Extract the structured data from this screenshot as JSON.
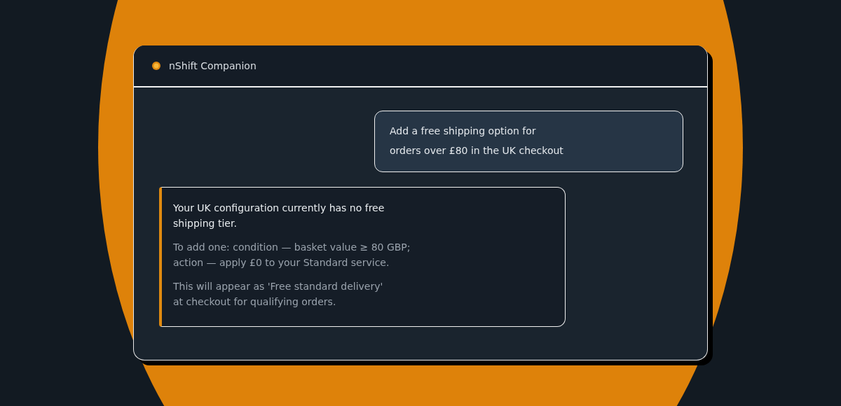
{
  "window": {
    "title": "nShift Companion"
  },
  "messages": [
    {
      "kind": "user",
      "paragraphs": [
        "Add a free shipping option for\norders over £80 in the UK checkout"
      ]
    },
    {
      "kind": "assistant",
      "paragraphs": [
        "Your UK configuration currently has no free\nshipping tier.",
        "To add one: condition — basket value ≥ 80 GBP;\naction — apply £0 to your Standard service.",
        "This will appear as 'Free standard delivery'\nat checkout for qualifying orders."
      ]
    }
  ]
}
